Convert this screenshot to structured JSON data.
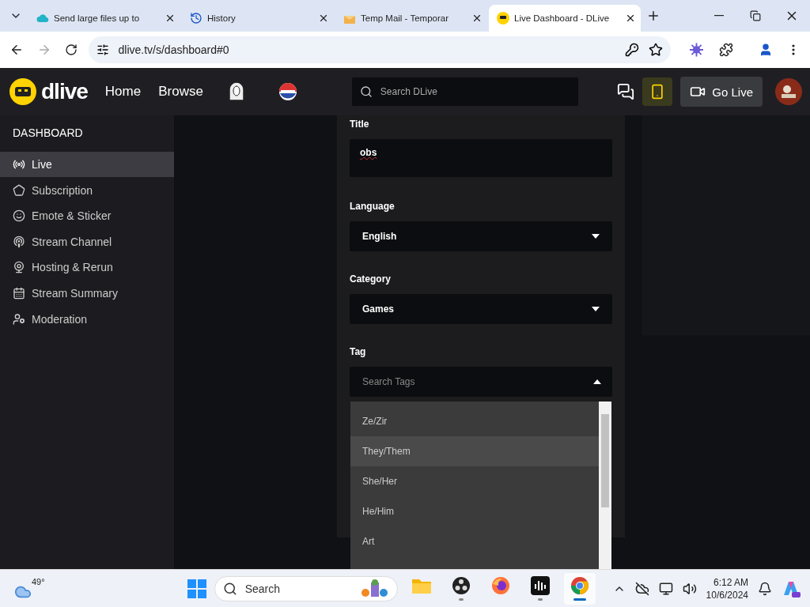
{
  "browser": {
    "tabs": [
      {
        "title": "Send large files up to",
        "selected": false
      },
      {
        "title": "History",
        "selected": false
      },
      {
        "title": "Temp Mail - Temporar",
        "selected": false
      },
      {
        "title": "Live Dashboard - DLive",
        "selected": true
      }
    ],
    "address": "dlive.tv/s/dashboard#0"
  },
  "header": {
    "logo": "dlive",
    "nav": [
      "Home",
      "Browse"
    ],
    "search": {
      "placeholder": "Search DLive"
    },
    "go_live": "Go Live"
  },
  "sidebar": {
    "title": "DASHBOARD",
    "items": [
      {
        "label": "Live",
        "selected": true
      },
      {
        "label": "Subscription",
        "selected": false
      },
      {
        "label": "Emote & Sticker",
        "selected": false
      },
      {
        "label": "Stream Channel",
        "selected": false
      },
      {
        "label": "Hosting & Rerun",
        "selected": false
      },
      {
        "label": "Stream Summary",
        "selected": false
      },
      {
        "label": "Moderation",
        "selected": false
      }
    ]
  },
  "form": {
    "title": {
      "label": "Title",
      "value": "obs"
    },
    "language": {
      "label": "Language",
      "value": "English"
    },
    "category": {
      "label": "Category",
      "value": "Games"
    },
    "tag": {
      "label": "Tag",
      "placeholder": "Search Tags",
      "expanded": true,
      "options": [
        {
          "label": "Ze/Zir",
          "highlighted": false
        },
        {
          "label": "They/Them",
          "highlighted": true
        },
        {
          "label": "She/Her",
          "highlighted": false
        },
        {
          "label": "He/Him",
          "highlighted": false
        },
        {
          "label": "Art",
          "highlighted": false
        }
      ]
    }
  },
  "taskbar": {
    "weather": "49°",
    "search": {
      "placeholder": "Search"
    },
    "apps": [
      {
        "kind": "files",
        "running": false,
        "active": false
      },
      {
        "kind": "obs",
        "running": true,
        "active": false
      },
      {
        "kind": "firefox",
        "running": false,
        "active": false
      },
      {
        "kind": "audio",
        "running": true,
        "active": false
      },
      {
        "kind": "chrome",
        "running": true,
        "active": true
      }
    ],
    "time": "6:12 AM",
    "date": "10/6/2024"
  }
}
